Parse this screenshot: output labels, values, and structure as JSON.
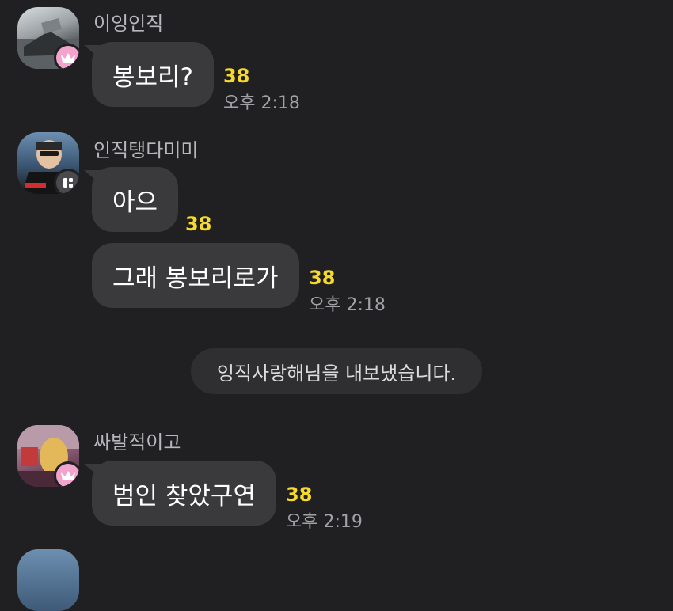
{
  "messages": [
    {
      "sender": "이잉인직",
      "badge_icon": "crown-icon",
      "bubbles": [
        {
          "text": "봉보리?",
          "unread": "38",
          "time": "오후 2:18"
        }
      ]
    },
    {
      "sender": "인직탱다미미",
      "badge_icon": "manager-icon",
      "bubbles": [
        {
          "text": "아으",
          "unread": "38"
        },
        {
          "text": "그래 봉보리로가",
          "unread": "38",
          "time": "오후 2:18"
        }
      ]
    },
    {
      "sender": "싸발적이고",
      "badge_icon": "crown-icon",
      "bubbles": [
        {
          "text": "범인 찾았구연",
          "unread": "38",
          "time": "오후 2:19"
        }
      ]
    }
  ],
  "system_message": "잉직사랑해님을 내보냈습니다.",
  "colors": {
    "background": "#202022",
    "bubble": "#3a3a3d",
    "unread": "#f6d92d",
    "crown_badge": "#f2a4cd"
  }
}
